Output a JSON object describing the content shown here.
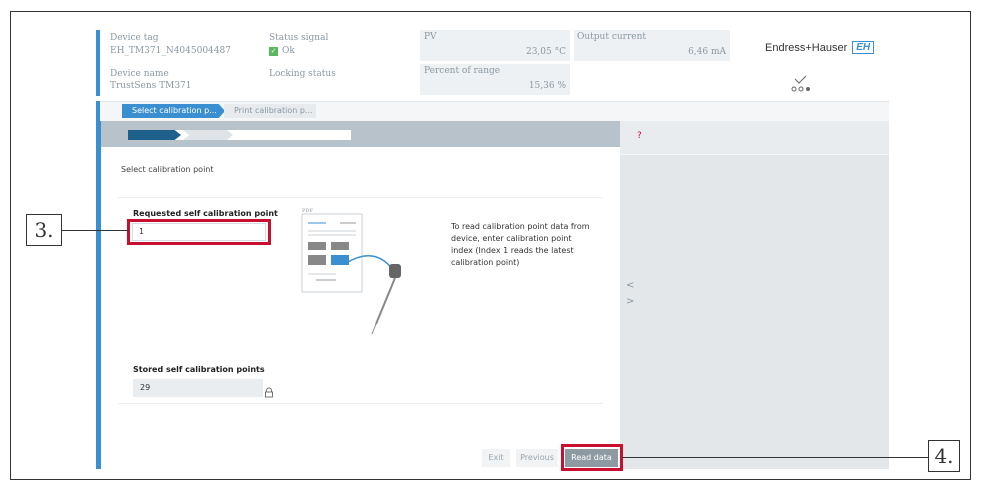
{
  "header": {
    "device_tag_label": "Device tag",
    "device_tag_value": "EH_TM371_N4045004487",
    "device_name_label": "Device name",
    "device_name_value": "TrustSens TM371",
    "status_signal_label": "Status signal",
    "status_signal_value": "Ok",
    "locking_status_label": "Locking status",
    "pv_label": "PV",
    "pv_value": "23,05 °C",
    "output_current_label": "Output current",
    "output_current_value": "6,46 mA",
    "percent_of_range_label": "Percent of range",
    "percent_of_range_value": "15,36 %",
    "brand": "Endress+Hauser",
    "brand_mark": "EH"
  },
  "tabs": [
    {
      "label": "Select calibration p..."
    },
    {
      "label": "Print calibration p..."
    }
  ],
  "wizard": {
    "step_title": "Select calibration point",
    "requested_label": "Requested self calibration point",
    "requested_value": "1",
    "pdf_label": "PDF",
    "help_text": "To read calibration point data from device, enter calibration point index (Index 1 reads the latest calibration point)",
    "stored_label": "Stored self calibration points",
    "stored_value": "29",
    "exit_label": "Exit",
    "previous_label": "Previous",
    "read_data_label": "Read data"
  },
  "help_panel": {
    "question_mark": "?",
    "prev_arrow": "<",
    "next_arrow": ">"
  },
  "callouts": {
    "three": "3.",
    "four": "4."
  },
  "colors": {
    "accent_blue": "#3a8fd0",
    "progress_dark": "#1f5f8b",
    "highlight_red": "#c8102e",
    "ok_green": "#5cb85c"
  }
}
